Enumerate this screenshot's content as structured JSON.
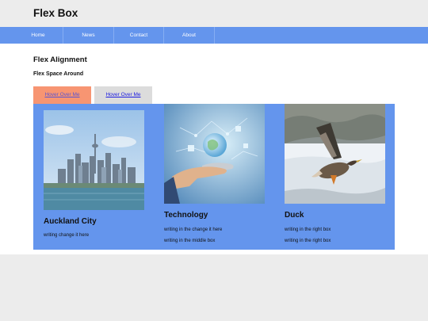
{
  "site": {
    "title": "Flex Box"
  },
  "nav": {
    "items": [
      "Home",
      "News",
      "Contact",
      "About"
    ]
  },
  "main": {
    "title": "Flex Alignment",
    "subtitle": "Flex Space Around",
    "buttons": [
      "Hover Over Me",
      "Hover Over Me"
    ]
  },
  "cards": [
    {
      "title": "Auckland City",
      "texts": [
        "writing change it here"
      ],
      "image": "auckland-skyline-photo"
    },
    {
      "title": "Technology",
      "texts": [
        "writing in the change it here",
        "writing in the middle box"
      ],
      "image": "hand-holding-globe-tech-photo"
    },
    {
      "title": "Duck",
      "texts": [
        "writing in the right box",
        "writing in the right box"
      ],
      "image": "flying-duck-photo"
    }
  ],
  "colors": {
    "nav": "#6495ed",
    "flex_box": "#6495ed",
    "button_hover": "#f79572",
    "button_default": "#dcdcdc"
  }
}
